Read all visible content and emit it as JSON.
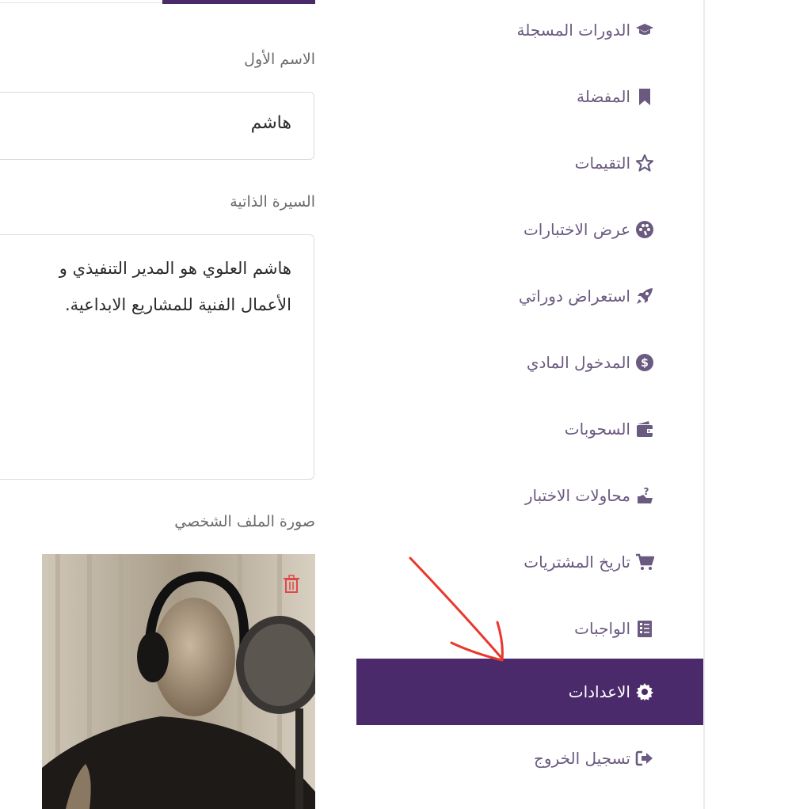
{
  "form": {
    "first_name_label": "الاسم الأول",
    "first_name_value": "هاشم",
    "bio_label": "السيرة الذاتية",
    "bio_line1": "هاشم العلوي هو المدير التنفيذي و",
    "bio_line2": "الأعمال الفنية للمشاريع الابداعية.",
    "photo_label": "صورة الملف الشخصي"
  },
  "sidebar": {
    "items": [
      {
        "label": "الدورات المسجلة",
        "icon": "graduation-cap-icon"
      },
      {
        "label": "المفضلة",
        "icon": "bookmark-icon"
      },
      {
        "label": "التقيمات",
        "icon": "star-icon"
      },
      {
        "label": "عرض الاختبارات",
        "icon": "palette-icon"
      },
      {
        "label": "استعراض دوراتي",
        "icon": "rocket-icon"
      },
      {
        "label": "المدخول المادي",
        "icon": "dollar-circle-icon"
      },
      {
        "label": "السحوبات",
        "icon": "wallet-icon"
      },
      {
        "label": "محاولات الاختبار",
        "icon": "question-hand-icon"
      },
      {
        "label": "تاريخ المشتريات",
        "icon": "cart-icon"
      },
      {
        "label": "الواجبات",
        "icon": "tasks-icon"
      },
      {
        "label": "الاعدادات",
        "icon": "gear-icon",
        "active": true
      },
      {
        "label": "تسجيل الخروج",
        "icon": "sign-out-icon"
      }
    ]
  },
  "colors": {
    "accent": "#4a2a6b",
    "nav_text": "#6a5a80",
    "annotation_arrow": "#e8382c",
    "delete_icon": "#e04848"
  }
}
